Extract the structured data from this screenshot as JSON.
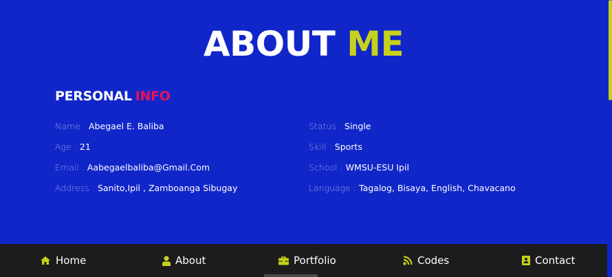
{
  "heading": {
    "main": "ABOUT",
    "accent": "ME"
  },
  "section": {
    "main": "PERSONAL",
    "accent": "INFO"
  },
  "info": {
    "left": [
      {
        "label": "Name :",
        "value": "Abegael E. Baliba"
      },
      {
        "label": "Age :",
        "value": "21"
      },
      {
        "label": "Email :",
        "value": "Aabegaelbaliba@Gmail.Com"
      },
      {
        "label": "Address :",
        "value": "Sanito,Ipil , Zamboanga Sibugay"
      }
    ],
    "right": [
      {
        "label": "Status :",
        "value": "Single"
      },
      {
        "label": "Skill :",
        "value": "Sports"
      },
      {
        "label": "School :",
        "value": "WMSU-ESU Ipil"
      },
      {
        "label": "Language :",
        "value": "Tagalog, Bisaya, English, Chavacano"
      }
    ]
  },
  "nav": {
    "items": [
      {
        "label": "Home",
        "icon": "home-icon"
      },
      {
        "label": "About",
        "icon": "user-icon"
      },
      {
        "label": "Portfolio",
        "icon": "briefcase-icon"
      },
      {
        "label": "Codes",
        "icon": "rss-icon"
      },
      {
        "label": "Contact",
        "icon": "address-book-icon"
      }
    ]
  },
  "colors": {
    "background": "#1126c9",
    "accent_yellow": "#c7d11b",
    "accent_pink": "#e5135a",
    "navbar": "#1c1c1c"
  }
}
